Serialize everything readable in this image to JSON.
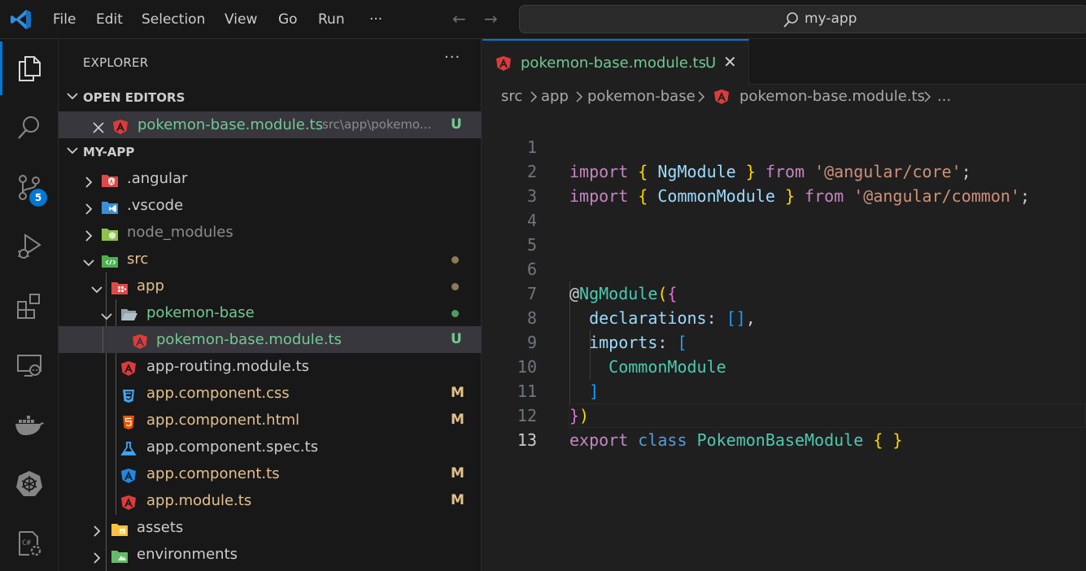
{
  "titlebar": {
    "menu": [
      "File",
      "Edit",
      "Selection",
      "View",
      "Go",
      "Run",
      "···"
    ],
    "search_text": "my-app"
  },
  "activitybar": {
    "items": [
      "explorer-icon",
      "search-icon",
      "source-control-icon",
      "run-debug-icon",
      "extensions-icon",
      "remote-explorer-icon",
      "docker-icon",
      "kubernetes-icon",
      "remote-settings-icon"
    ],
    "source_control_badge": "5"
  },
  "sidebar": {
    "title": "EXPLORER",
    "more": "···",
    "open_editors_label": "OPEN EDITORS",
    "open_editor": {
      "name": "pokemon-base.module.ts",
      "path": "src\\app\\pokemo...",
      "status": "U"
    },
    "project_label": "MY-APP",
    "tree": [
      {
        "name": ".angular",
        "status": ""
      },
      {
        "name": ".vscode",
        "status": ""
      },
      {
        "name": "node_modules",
        "status": ""
      },
      {
        "name": "src",
        "status": ""
      },
      {
        "name": "app",
        "status": ""
      },
      {
        "name": "pokemon-base",
        "status": ""
      },
      {
        "name": "pokemon-base.module.ts",
        "status": "U"
      },
      {
        "name": "app-routing.module.ts",
        "status": ""
      },
      {
        "name": "app.component.css",
        "status": "M"
      },
      {
        "name": "app.component.html",
        "status": "M"
      },
      {
        "name": "app.component.spec.ts",
        "status": ""
      },
      {
        "name": "app.component.ts",
        "status": "M"
      },
      {
        "name": "app.module.ts",
        "status": "M"
      },
      {
        "name": "assets",
        "status": ""
      },
      {
        "name": "environments",
        "status": ""
      }
    ]
  },
  "editor": {
    "tab": {
      "label": "pokemon-base.module.ts",
      "status": "U"
    },
    "breadcrumb": [
      "src",
      "app",
      "pokemon-base",
      "pokemon-base.module.ts",
      "..."
    ],
    "line_numbers": [
      "1",
      "2",
      "3",
      "4",
      "5",
      "6",
      "7",
      "8",
      "9",
      "10",
      "11",
      "12",
      "13"
    ],
    "code": {
      "l1": {
        "t1": "import",
        "t2": "{",
        "t3": "NgModule",
        "t4": "}",
        "t5": "from",
        "t6": "'@angular/core'",
        "t7": ";"
      },
      "l2": {
        "t1": "import",
        "t2": "{",
        "t3": "CommonModule",
        "t4": "}",
        "t5": "from",
        "t6": "'@angular/common'",
        "t7": ";"
      },
      "l6": {
        "t1": "@",
        "t2": "NgModule",
        "t3": "(",
        "t4": "{"
      },
      "l7": {
        "t1": "declarations",
        "t2": ":",
        "t3": "[]",
        "t4": ","
      },
      "l8": {
        "t1": "imports",
        "t2": ":",
        "t3": "["
      },
      "l9": {
        "t1": "CommonModule"
      },
      "l10": {
        "t1": "]"
      },
      "l11": {
        "t1": "}",
        "t2": ")"
      },
      "l12": {
        "t1": "export",
        "t2": "class",
        "t3": "PokemonBaseModule",
        "t4": "{",
        "t5": "}"
      }
    }
  },
  "colors": {
    "accent": "#0078d4",
    "untracked": "#73c991",
    "modified": "#e2c08d",
    "angular_red": "#dd3b3b"
  }
}
